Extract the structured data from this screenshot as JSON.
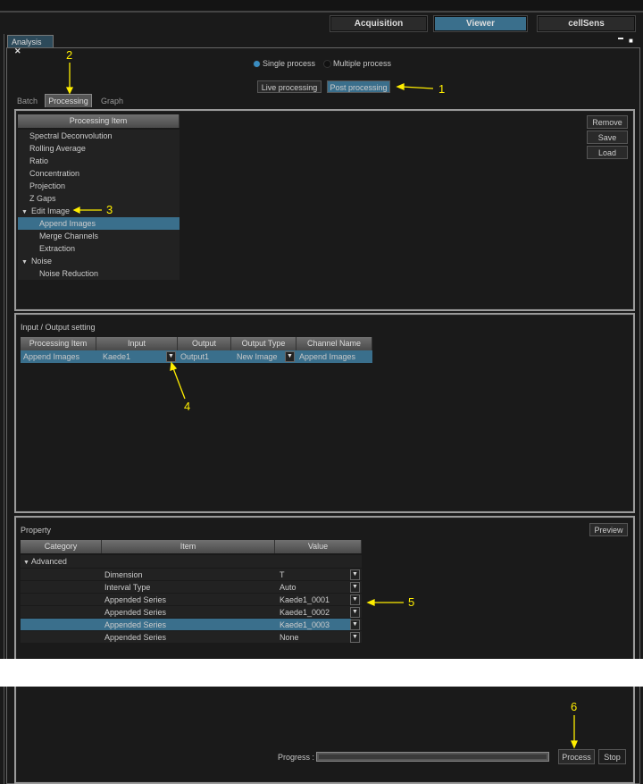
{
  "top_nav": {
    "acquisition": "Acquisition",
    "viewer": "Viewer",
    "cellsens": "cellSens"
  },
  "panel": {
    "tab_label": "Analysis",
    "close": "✕",
    "minimize": "▬",
    "maximize": "■"
  },
  "mode": {
    "single": "Single process",
    "multiple": "Multiple process",
    "selected": "single"
  },
  "processing_type": {
    "live": "Live processing",
    "post": "Post processing",
    "selected": "post"
  },
  "tabs": [
    {
      "label": "Batch"
    },
    {
      "label": "Processing",
      "active": true
    },
    {
      "label": "Graph"
    }
  ],
  "processing_list": {
    "header": "Processing Item",
    "items": [
      {
        "label": "Spectral Deconvolution",
        "level": 0
      },
      {
        "label": "Rolling Average",
        "level": 0
      },
      {
        "label": "Ratio",
        "level": 0
      },
      {
        "label": "Concentration",
        "level": 0
      },
      {
        "label": "Projection",
        "level": 0
      },
      {
        "label": "Z Gaps",
        "level": 0
      },
      {
        "label": "Edit Image",
        "level": 0,
        "expander": "▼"
      },
      {
        "label": "Append Images",
        "level": 1,
        "selected": true
      },
      {
        "label": "Merge Channels",
        "level": 1
      },
      {
        "label": "Extraction",
        "level": 1
      },
      {
        "label": "Noise",
        "level": 0,
        "expander": "▼"
      },
      {
        "label": "Noise Reduction",
        "level": 1
      }
    ]
  },
  "list_buttons": {
    "remove": "Remove",
    "save": "Save",
    "load": "Load"
  },
  "io": {
    "title": "Input / Output setting",
    "headers": [
      "Processing Item",
      "Input",
      "Output",
      "Output Type",
      "Channel Name"
    ],
    "row": {
      "item": "Append Images",
      "input": "Kaede1",
      "output": "Output1",
      "output_type": "New Image",
      "channel": "Append Images"
    }
  },
  "property": {
    "title": "Property",
    "preview": "Preview",
    "headers": [
      "Category",
      "Item",
      "Value"
    ],
    "category": "Advanced",
    "rows": [
      {
        "item": "Dimension",
        "value": "T"
      },
      {
        "item": "Interval Type",
        "value": "Auto"
      },
      {
        "item": "Appended Series",
        "value": "Kaede1_0001"
      },
      {
        "item": "Appended Series",
        "value": "Kaede1_0002"
      },
      {
        "item": "Appended Series",
        "value": "Kaede1_0003",
        "selected": true
      },
      {
        "item": "Appended Series",
        "value": "None"
      }
    ]
  },
  "footer": {
    "progress_label": "Progress :",
    "progress": 0,
    "process": "Process",
    "stop": "Stop"
  },
  "annotations": [
    "1",
    "2",
    "3",
    "4",
    "5",
    "6"
  ],
  "colors": {
    "accent": "#3a6f8c",
    "annotation": "#ffee00",
    "background": "#1a1a1a"
  }
}
